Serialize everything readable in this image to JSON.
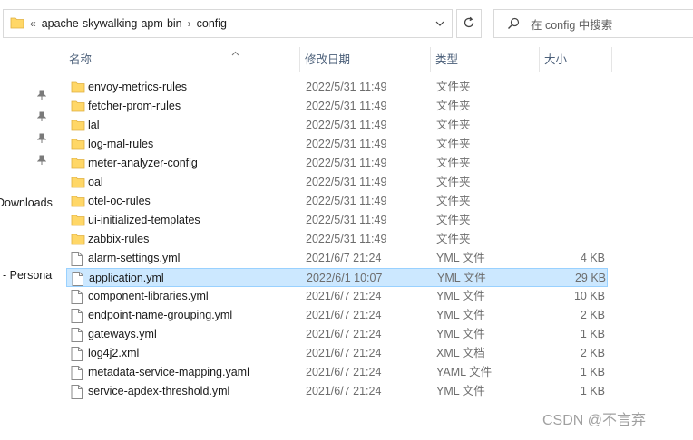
{
  "address_bar": {
    "overflow": "«",
    "crumbs": [
      "apache-skywalking-apm-bin",
      "config"
    ],
    "separator": "›"
  },
  "search": {
    "placeholder": "在 config 中搜索"
  },
  "nav": {
    "items": [
      "Downloads",
      "- Persona"
    ]
  },
  "columns": {
    "name": "名称",
    "date": "修改日期",
    "type": "类型",
    "size": "大小"
  },
  "files": [
    {
      "name": "envoy-metrics-rules",
      "date": "2022/5/31 11:49",
      "type": "文件夹",
      "size": "",
      "icon": "folder-icon"
    },
    {
      "name": "fetcher-prom-rules",
      "date": "2022/5/31 11:49",
      "type": "文件夹",
      "size": "",
      "icon": "folder-icon"
    },
    {
      "name": "lal",
      "date": "2022/5/31 11:49",
      "type": "文件夹",
      "size": "",
      "icon": "folder-icon"
    },
    {
      "name": "log-mal-rules",
      "date": "2022/5/31 11:49",
      "type": "文件夹",
      "size": "",
      "icon": "folder-icon"
    },
    {
      "name": "meter-analyzer-config",
      "date": "2022/5/31 11:49",
      "type": "文件夹",
      "size": "",
      "icon": "folder-icon"
    },
    {
      "name": "oal",
      "date": "2022/5/31 11:49",
      "type": "文件夹",
      "size": "",
      "icon": "folder-icon"
    },
    {
      "name": "otel-oc-rules",
      "date": "2022/5/31 11:49",
      "type": "文件夹",
      "size": "",
      "icon": "folder-icon"
    },
    {
      "name": "ui-initialized-templates",
      "date": "2022/5/31 11:49",
      "type": "文件夹",
      "size": "",
      "icon": "folder-icon"
    },
    {
      "name": "zabbix-rules",
      "date": "2022/5/31 11:49",
      "type": "文件夹",
      "size": "",
      "icon": "folder-icon"
    },
    {
      "name": "alarm-settings.yml",
      "date": "2021/6/7 21:24",
      "type": "YML 文件",
      "size": "4 KB",
      "icon": "file-icon"
    },
    {
      "name": "application.yml",
      "date": "2022/6/1 10:07",
      "type": "YML 文件",
      "size": "29 KB",
      "icon": "file-icon",
      "selected": true
    },
    {
      "name": "component-libraries.yml",
      "date": "2021/6/7 21:24",
      "type": "YML 文件",
      "size": "10 KB",
      "icon": "file-icon"
    },
    {
      "name": "endpoint-name-grouping.yml",
      "date": "2021/6/7 21:24",
      "type": "YML 文件",
      "size": "2 KB",
      "icon": "file-icon"
    },
    {
      "name": "gateways.yml",
      "date": "2021/6/7 21:24",
      "type": "YML 文件",
      "size": "1 KB",
      "icon": "file-icon"
    },
    {
      "name": "log4j2.xml",
      "date": "2021/6/7 21:24",
      "type": "XML 文档",
      "size": "2 KB",
      "icon": "file-icon"
    },
    {
      "name": "metadata-service-mapping.yaml",
      "date": "2021/6/7 21:24",
      "type": "YAML 文件",
      "size": "1 KB",
      "icon": "file-icon"
    },
    {
      "name": "service-apdex-threshold.yml",
      "date": "2021/6/7 21:24",
      "type": "YML 文件",
      "size": "1 KB",
      "icon": "file-icon"
    }
  ],
  "watermark": "CSDN @不言弃",
  "colors": {
    "selection": "#cce8ff",
    "selection_border": "#99d1ff",
    "folder": "#ffd767",
    "header_text": "#4c607a"
  }
}
